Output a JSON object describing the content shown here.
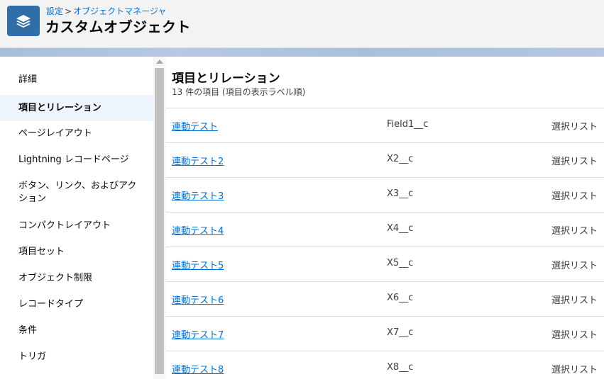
{
  "header": {
    "breadcrumb": [
      "設定",
      "オブジェクトマネージャ"
    ],
    "breadcrumb_separator": ">",
    "title": "カスタムオブジェクト",
    "icon": "layers-icon",
    "icon_color": "#2f6ea6"
  },
  "sidebar": {
    "active_index": 1,
    "items": [
      {
        "label": "詳細"
      },
      {
        "label": "項目とリレーション"
      },
      {
        "label": "ページレイアウト"
      },
      {
        "label": "Lightning レコードページ"
      },
      {
        "label": "ボタン、リンク、およびアクション"
      },
      {
        "label": "コンパクトレイアウト"
      },
      {
        "label": "項目セット"
      },
      {
        "label": "オブジェクト制限"
      },
      {
        "label": "レコードタイプ"
      },
      {
        "label": "条件"
      },
      {
        "label": "トリガ"
      }
    ]
  },
  "main": {
    "title": "項目とリレーション",
    "subtitle": "13 件の項目 (項目の表示ラベル順)",
    "rows": [
      {
        "label": "連動テスト",
        "api": "Field1__c",
        "type": "選択リスト"
      },
      {
        "label": "連動テスト2",
        "api": "X2__c",
        "type": "選択リスト"
      },
      {
        "label": "連動テスト3",
        "api": "X3__c",
        "type": "選択リスト"
      },
      {
        "label": "連動テスト4",
        "api": "X4__c",
        "type": "選択リスト"
      },
      {
        "label": "連動テスト5",
        "api": "X5__c",
        "type": "選択リスト"
      },
      {
        "label": "連動テスト6",
        "api": "X6__c",
        "type": "選択リスト"
      },
      {
        "label": "連動テスト7",
        "api": "X7__c",
        "type": "選択リスト"
      },
      {
        "label": "連動テスト8",
        "api": "X8__c",
        "type": "選択リスト"
      }
    ]
  },
  "colors": {
    "link": "#0070d2",
    "active_bg": "#eef4fb"
  }
}
